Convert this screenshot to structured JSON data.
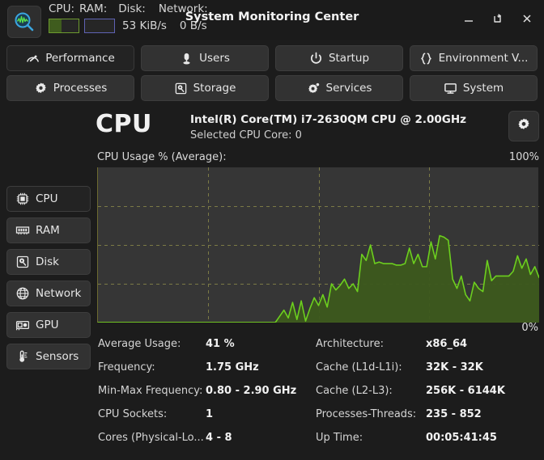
{
  "window": {
    "title": "System Monitoring Center",
    "app_icon": "magnifier-waveform-icon",
    "controls": [
      {
        "name": "minimize-button",
        "icon": "minimize-icon"
      },
      {
        "name": "restore-button",
        "icon": "restore-icon"
      },
      {
        "name": "close-button",
        "icon": "close-icon"
      }
    ]
  },
  "perf_strip": {
    "cpu_label": "CPU:",
    "ram_label": "RAM:",
    "disk_label": "Disk:",
    "network_label": "Network:",
    "cpu_bar_percent": 41,
    "ram_bar_percent": 0,
    "disk_value": "53 KiB/s",
    "network_value": "0 B/s",
    "cpu_bar_color": "#6d9b2f",
    "ram_bar_color": "#5f62b4"
  },
  "toolbar": {
    "rows": [
      [
        {
          "label": "Performance",
          "icon": "gauge-icon",
          "active": true
        },
        {
          "label": "Users",
          "icon": "user-icon",
          "active": false
        },
        {
          "label": "Startup",
          "icon": "power-icon",
          "active": false
        },
        {
          "label": "Environment V...",
          "icon": "braces-icon",
          "active": false
        }
      ],
      [
        {
          "label": "Processes",
          "icon": "gear-icon",
          "active": false
        },
        {
          "label": "Storage",
          "icon": "hdd-icon",
          "active": false
        },
        {
          "label": "Services",
          "icon": "gear-dot-icon",
          "active": false
        },
        {
          "label": "System",
          "icon": "monitor-icon",
          "active": false
        }
      ]
    ]
  },
  "sidebar": {
    "items": [
      {
        "label": "CPU",
        "icon": "chip-icon",
        "active": true
      },
      {
        "label": "RAM",
        "icon": "memory-icon",
        "active": false
      },
      {
        "label": "Disk",
        "icon": "hdd-icon",
        "active": false
      },
      {
        "label": "Network",
        "icon": "globe-icon",
        "active": false
      },
      {
        "label": "GPU",
        "icon": "gpu-card-icon",
        "active": false
      },
      {
        "label": "Sensors",
        "icon": "thermometer-icon",
        "active": false
      }
    ]
  },
  "cpu_panel": {
    "heading": "CPU",
    "model": "Intel(R) Core(TM) i7-2630QM CPU @ 2.00GHz",
    "selected_core": "Selected CPU Core: 0",
    "settings_icon": "gear-icon",
    "chart_label": "CPU Usage % (Average):",
    "axis_max_label": "100%",
    "axis_min_label": "0%"
  },
  "details": {
    "left": [
      {
        "key": "Average Usage:",
        "value": "41 %"
      },
      {
        "key": "Frequency:",
        "value": "1.75 GHz"
      },
      {
        "key": "Min-Max Frequency:",
        "value": "0.80 - 2.90 GHz"
      },
      {
        "key": "CPU Sockets:",
        "value": "1"
      },
      {
        "key": "Cores (Physical-Lo...",
        "value": "4 - 8"
      }
    ],
    "right": [
      {
        "key": "Architecture:",
        "value": "x86_64"
      },
      {
        "key": "Cache (L1d-L1i):",
        "value": "32K - 32K"
      },
      {
        "key": "Cache (L2-L3):",
        "value": "256K - 6144K"
      },
      {
        "key": "Processes-Threads:",
        "value": "235 - 852"
      },
      {
        "key": "Up Time:",
        "value": "00:05:41:45"
      }
    ]
  },
  "chart_data": {
    "type": "area",
    "title": "CPU Usage % (Average):",
    "xlabel": "",
    "ylabel": "CPU Usage %",
    "ylim": [
      0,
      100
    ],
    "grid": true,
    "grid_rows": 4,
    "grid_cols": 4,
    "line_color": "#6ccf1e",
    "fill_color": "#3d5a1d",
    "plot_bg": "#363636",
    "legend": "none",
    "values": [
      0,
      0,
      0,
      0,
      0,
      0,
      0,
      0,
      0,
      0,
      0,
      0,
      0,
      0,
      0,
      0,
      0,
      0,
      0,
      0,
      0,
      0,
      0,
      0,
      0,
      0,
      0,
      0,
      0,
      0,
      0,
      0,
      0,
      0,
      0,
      0,
      0,
      0,
      0,
      0,
      0,
      0,
      4,
      8,
      3,
      13,
      2,
      14,
      1,
      9,
      16,
      11,
      18,
      10,
      25,
      21,
      24,
      28,
      22,
      25,
      20,
      44,
      40,
      50,
      38,
      39,
      38,
      38,
      38,
      37,
      37,
      38,
      48,
      38,
      44,
      36,
      36,
      52,
      41,
      56,
      55,
      53,
      28,
      22,
      30,
      18,
      14,
      26,
      22,
      20,
      40,
      27,
      30,
      30,
      30,
      30,
      33,
      43,
      35,
      41,
      31,
      36,
      29
    ]
  }
}
